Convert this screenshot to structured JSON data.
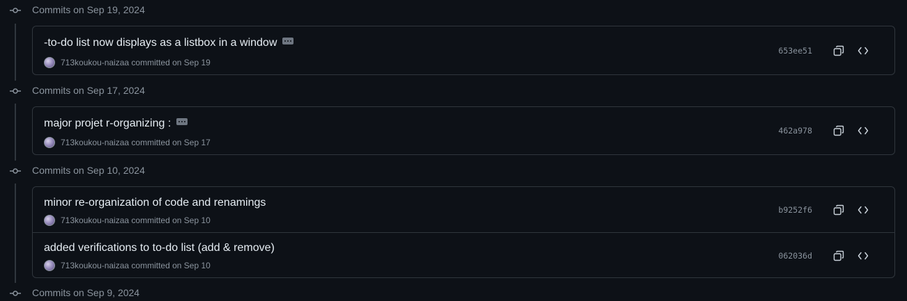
{
  "groups": [
    {
      "header": "Commits on Sep 19, 2024",
      "commits": [
        {
          "title": "-to-do list now displays as a listbox in a window",
          "has_more": true,
          "author": "713koukou-naizaa",
          "committed": "committed on Sep 19",
          "sha": "653ee51"
        }
      ]
    },
    {
      "header": "Commits on Sep 17, 2024",
      "commits": [
        {
          "title": "major projet r-organizing :",
          "has_more": true,
          "author": "713koukou-naizaa",
          "committed": "committed on Sep 17",
          "sha": "462a978"
        }
      ]
    },
    {
      "header": "Commits on Sep 10, 2024",
      "commits": [
        {
          "title": "minor re-organization of code and renamings",
          "has_more": false,
          "author": "713koukou-naizaa",
          "committed": "committed on Sep 10",
          "sha": "b9252f6"
        },
        {
          "title": "added verifications to to-do list (add & remove)",
          "has_more": false,
          "author": "713koukou-naizaa",
          "committed": "committed on Sep 10",
          "sha": "062036d"
        }
      ]
    },
    {
      "header": "Commits on Sep 9, 2024",
      "commits": []
    }
  ],
  "icons": {
    "commit": "git-commit-icon",
    "ellipsis": "ellipsis-icon",
    "copy": "copy-icon",
    "browse": "code-icon",
    "avatar": "avatar"
  },
  "colors": {
    "background": "#0d1117",
    "border": "#30363d",
    "text": "#e6edf3",
    "muted": "#8b949e"
  }
}
